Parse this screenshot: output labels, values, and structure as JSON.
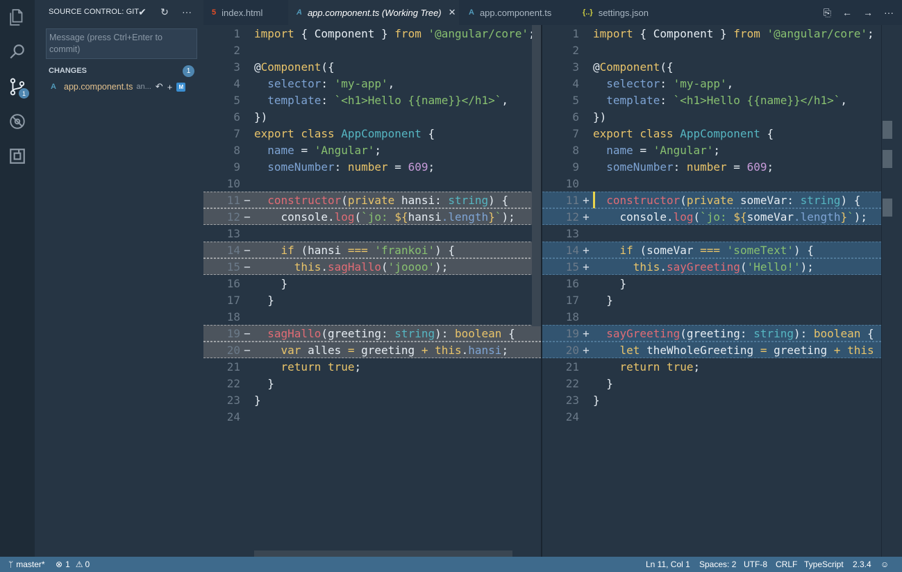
{
  "colors": {
    "keyword": "#e9c46a",
    "string": "#88c070",
    "function": "#e06c75",
    "type": "#56b6c2",
    "property": "#7ea4d4",
    "number": "#c79bd9",
    "plain": "#e6edf3",
    "accent": "#4e86b0"
  },
  "activity": {
    "items": [
      {
        "name": "explorer-icon"
      },
      {
        "name": "search-icon"
      },
      {
        "name": "source-control-icon",
        "badge": "1"
      },
      {
        "name": "debug-icon"
      },
      {
        "name": "extensions-icon"
      }
    ]
  },
  "sidebar": {
    "title": "SOURCE CONTROL: GIT",
    "commit_placeholder": "Message (press Ctrl+Enter to commit)",
    "changes_label": "CHANGES",
    "changes_count": "1",
    "file": {
      "name": "app.component.ts",
      "path": "an...",
      "status": "M"
    }
  },
  "tabs": [
    {
      "label": "index.html",
      "icon": "html5-icon",
      "icon_glyph": "5",
      "color": "#e44d26",
      "active": false
    },
    {
      "label": "app.component.ts (Working Tree)",
      "icon": "angular-icon",
      "icon_glyph": "A",
      "color": "#519aba",
      "active": true
    },
    {
      "label": "app.component.ts",
      "icon": "angular-icon",
      "icon_glyph": "A",
      "color": "#519aba",
      "active": false
    },
    {
      "label": "settings.json",
      "icon": "json-icon",
      "icon_glyph": "{..}",
      "color": "#cbcb41",
      "active": false
    }
  ],
  "editor_left": {
    "lines": [
      {
        "n": "1",
        "code": [
          [
            "kw",
            "import "
          ],
          [
            "p",
            "{ Component } "
          ],
          [
            "kw",
            "from "
          ],
          [
            "str",
            "'@angular/core'"
          ],
          [
            "p",
            ";"
          ]
        ]
      },
      {
        "n": "2",
        "code": []
      },
      {
        "n": "3",
        "code": [
          [
            "p",
            "@"
          ],
          [
            "kw",
            "Component"
          ],
          [
            "p",
            "({"
          ]
        ]
      },
      {
        "n": "4",
        "code": [
          [
            "prop",
            "  selector"
          ],
          [
            "p",
            ": "
          ],
          [
            "str",
            "'my-app'"
          ],
          [
            "p",
            ","
          ]
        ]
      },
      {
        "n": "5",
        "code": [
          [
            "prop",
            "  template"
          ],
          [
            "p",
            ": "
          ],
          [
            "str",
            "`<h1>Hello {{name}}</h1>`"
          ],
          [
            "p",
            ","
          ]
        ]
      },
      {
        "n": "6",
        "code": [
          [
            "p",
            "})"
          ]
        ]
      },
      {
        "n": "7",
        "code": [
          [
            "kw",
            "export class "
          ],
          [
            "type",
            "AppComponent "
          ],
          [
            "p",
            "{"
          ]
        ]
      },
      {
        "n": "8",
        "code": [
          [
            "prop",
            "  name "
          ],
          [
            "p",
            "= "
          ],
          [
            "str",
            "'Angular'"
          ],
          [
            "p",
            ";"
          ]
        ]
      },
      {
        "n": "9",
        "code": [
          [
            "prop",
            "  someNumber"
          ],
          [
            "p",
            ": "
          ],
          [
            "kw",
            "number "
          ],
          [
            "p",
            "= "
          ],
          [
            "num",
            "609"
          ],
          [
            "p",
            ";"
          ]
        ]
      },
      {
        "n": "10",
        "code": []
      },
      {
        "n": "11",
        "mark": "del",
        "g": "−",
        "code": [
          [
            "fn",
            "  constructor"
          ],
          [
            "p",
            "("
          ],
          [
            "kw",
            "private "
          ],
          [
            "p",
            "hansi"
          ],
          [
            "p",
            ": "
          ],
          [
            "type",
            "string"
          ],
          [
            "p",
            ") {"
          ]
        ]
      },
      {
        "n": "12",
        "mark": "del",
        "g": "−",
        "code": [
          [
            "p",
            "    console."
          ],
          [
            "fn",
            "log"
          ],
          [
            "p",
            "("
          ],
          [
            "str",
            "`jo: "
          ],
          [
            "kw",
            "${"
          ],
          [
            "p",
            "hansi"
          ],
          [
            "prop",
            ".length"
          ],
          [
            "kw",
            "}"
          ],
          [
            "str",
            "`"
          ],
          [
            "p",
            ");"
          ]
        ]
      },
      {
        "n": "13",
        "code": []
      },
      {
        "n": "14",
        "mark": "del",
        "g": "−",
        "code": [
          [
            "kw",
            "    if "
          ],
          [
            "p",
            "(hansi "
          ],
          [
            "kw",
            "=== "
          ],
          [
            "str",
            "'frankoi'"
          ],
          [
            "p",
            ") {"
          ]
        ]
      },
      {
        "n": "15",
        "mark": "del",
        "g": "−",
        "code": [
          [
            "kw",
            "      this"
          ],
          [
            "p",
            "."
          ],
          [
            "fn",
            "sagHallo"
          ],
          [
            "p",
            "("
          ],
          [
            "str",
            "'joooo'"
          ],
          [
            "p",
            ");"
          ]
        ]
      },
      {
        "n": "16",
        "code": [
          [
            "p",
            "    }"
          ]
        ]
      },
      {
        "n": "17",
        "code": [
          [
            "p",
            "  }"
          ]
        ]
      },
      {
        "n": "18",
        "code": []
      },
      {
        "n": "19",
        "mark": "del",
        "g": "−",
        "code": [
          [
            "fn",
            "  sagHallo"
          ],
          [
            "p",
            "(greeting: "
          ],
          [
            "type",
            "string"
          ],
          [
            "p",
            "): "
          ],
          [
            "kw",
            "boolean "
          ],
          [
            "p",
            "{"
          ]
        ]
      },
      {
        "n": "20",
        "mark": "del",
        "g": "−",
        "code": [
          [
            "kw",
            "    var "
          ],
          [
            "p",
            "alles "
          ],
          [
            "kw",
            "= "
          ],
          [
            "p",
            "greeting "
          ],
          [
            "kw",
            "+ "
          ],
          [
            "kw",
            "this"
          ],
          [
            "p",
            "."
          ],
          [
            "prop",
            "hansi"
          ],
          [
            "p",
            ";"
          ]
        ]
      },
      {
        "n": "21",
        "code": [
          [
            "kw",
            "    return true"
          ],
          [
            "p",
            ";"
          ]
        ]
      },
      {
        "n": "22",
        "code": [
          [
            "p",
            "  }"
          ]
        ]
      },
      {
        "n": "23",
        "code": [
          [
            "p",
            "}"
          ]
        ]
      },
      {
        "n": "24",
        "code": []
      }
    ]
  },
  "editor_right": {
    "lines": [
      {
        "n": "1",
        "code": [
          [
            "kw",
            "import "
          ],
          [
            "p",
            "{ Component } "
          ],
          [
            "kw",
            "from "
          ],
          [
            "str",
            "'@angular/core'"
          ],
          [
            "p",
            ";"
          ]
        ]
      },
      {
        "n": "2",
        "code": []
      },
      {
        "n": "3",
        "code": [
          [
            "p",
            "@"
          ],
          [
            "kw",
            "Component"
          ],
          [
            "p",
            "({"
          ]
        ]
      },
      {
        "n": "4",
        "code": [
          [
            "prop",
            "  selector"
          ],
          [
            "p",
            ": "
          ],
          [
            "str",
            "'my-app'"
          ],
          [
            "p",
            ","
          ]
        ]
      },
      {
        "n": "5",
        "code": [
          [
            "prop",
            "  template"
          ],
          [
            "p",
            ": "
          ],
          [
            "str",
            "`<h1>Hello {{name}}</h1>`"
          ],
          [
            "p",
            ","
          ]
        ]
      },
      {
        "n": "6",
        "code": [
          [
            "p",
            "})"
          ]
        ]
      },
      {
        "n": "7",
        "code": [
          [
            "kw",
            "export class "
          ],
          [
            "type",
            "AppComponent "
          ],
          [
            "p",
            "{"
          ]
        ]
      },
      {
        "n": "8",
        "code": [
          [
            "prop",
            "  name "
          ],
          [
            "p",
            "= "
          ],
          [
            "str",
            "'Angular'"
          ],
          [
            "p",
            ";"
          ]
        ]
      },
      {
        "n": "9",
        "code": [
          [
            "prop",
            "  someNumber"
          ],
          [
            "p",
            ": "
          ],
          [
            "kw",
            "number "
          ],
          [
            "p",
            "= "
          ],
          [
            "num",
            "609"
          ],
          [
            "p",
            ";"
          ]
        ]
      },
      {
        "n": "10",
        "code": []
      },
      {
        "n": "11",
        "mark": "ins",
        "g": "+",
        "code": [
          [
            "fn",
            "  constructor"
          ],
          [
            "p",
            "("
          ],
          [
            "kw",
            "private "
          ],
          [
            "p",
            "someVar"
          ],
          [
            "p",
            ": "
          ],
          [
            "type",
            "string"
          ],
          [
            "p",
            ") {"
          ]
        ]
      },
      {
        "n": "12",
        "mark": "ins",
        "g": "+",
        "code": [
          [
            "p",
            "    console."
          ],
          [
            "fn",
            "log"
          ],
          [
            "p",
            "("
          ],
          [
            "str",
            "`jo: "
          ],
          [
            "kw",
            "${"
          ],
          [
            "p",
            "someVar"
          ],
          [
            "prop",
            ".length"
          ],
          [
            "kw",
            "}"
          ],
          [
            "str",
            "`"
          ],
          [
            "p",
            ");"
          ]
        ]
      },
      {
        "n": "13",
        "code": []
      },
      {
        "n": "14",
        "mark": "ins",
        "g": "+",
        "code": [
          [
            "kw",
            "    if "
          ],
          [
            "p",
            "(someVar "
          ],
          [
            "kw",
            "=== "
          ],
          [
            "str",
            "'someText'"
          ],
          [
            "p",
            ") {"
          ]
        ]
      },
      {
        "n": "15",
        "mark": "ins",
        "g": "+",
        "code": [
          [
            "kw",
            "      this"
          ],
          [
            "p",
            "."
          ],
          [
            "fn",
            "sayGreeting"
          ],
          [
            "p",
            "("
          ],
          [
            "str",
            "'Hello!'"
          ],
          [
            "p",
            ");"
          ]
        ]
      },
      {
        "n": "16",
        "code": [
          [
            "p",
            "    }"
          ]
        ]
      },
      {
        "n": "17",
        "code": [
          [
            "p",
            "  }"
          ]
        ]
      },
      {
        "n": "18",
        "code": []
      },
      {
        "n": "19",
        "mark": "ins",
        "g": "+",
        "code": [
          [
            "fn",
            "  sayGreeting"
          ],
          [
            "p",
            "(greeting: "
          ],
          [
            "type",
            "string"
          ],
          [
            "p",
            "): "
          ],
          [
            "kw",
            "boolean "
          ],
          [
            "p",
            "{"
          ]
        ]
      },
      {
        "n": "20",
        "mark": "ins",
        "g": "+",
        "code": [
          [
            "kw",
            "    let "
          ],
          [
            "p",
            "theWholeGreeting "
          ],
          [
            "kw",
            "= "
          ],
          [
            "p",
            "greeting "
          ],
          [
            "kw",
            "+ "
          ],
          [
            "kw",
            "this"
          ]
        ]
      },
      {
        "n": "21",
        "code": [
          [
            "kw",
            "    return true"
          ],
          [
            "p",
            ";"
          ]
        ]
      },
      {
        "n": "22",
        "code": [
          [
            "p",
            "  }"
          ]
        ]
      },
      {
        "n": "23",
        "code": [
          [
            "p",
            "}"
          ]
        ]
      },
      {
        "n": "24",
        "code": []
      }
    ]
  },
  "status": {
    "branch": "master*",
    "errors": "1",
    "warnings": "0",
    "position": "Ln 11, Col 1",
    "spaces": "Spaces: 2",
    "encoding": "UTF-8",
    "eol": "CRLF",
    "language": "TypeScript",
    "version": "2.3.4"
  }
}
